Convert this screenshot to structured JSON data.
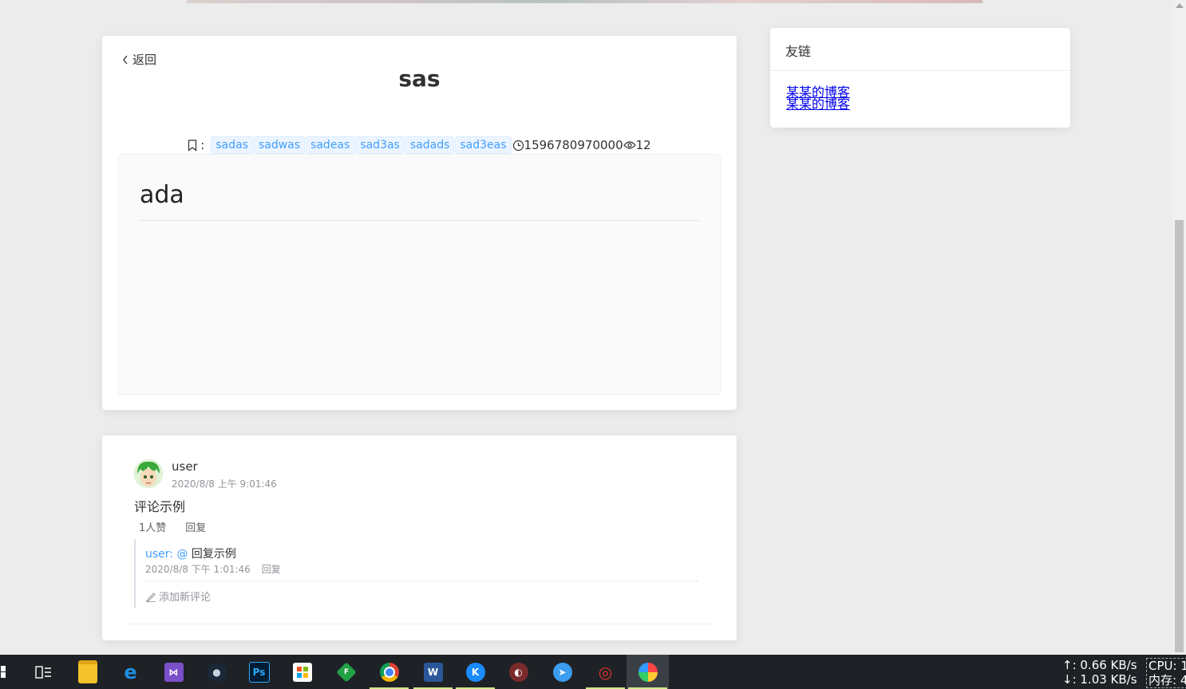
{
  "article": {
    "back_label": "返回",
    "title": "sas",
    "tag_label": ":",
    "tags": [
      "sadas",
      "sadwas",
      "sadeas",
      "sad3as",
      "sadads",
      "sad3eas"
    ],
    "timestamp": "1596780970000",
    "views": "12",
    "content_heading": "ada"
  },
  "friends": {
    "title": "友链",
    "links": [
      "某某的博客",
      "某某的博客"
    ]
  },
  "comment": {
    "user": "user",
    "time": "2020/8/8 上午 9:01:46",
    "text": "评论示例",
    "likes": "1人赞",
    "reply_label": "回复",
    "reply": {
      "user": "user:",
      "at": "@",
      "text": "回复示例",
      "time": "2020/8/8 下午 1:01:46",
      "reply_label": "回复"
    },
    "add_label": "添加新评论"
  },
  "taskbar": {
    "net_up": "↑: 0.66 KB/s",
    "net_down": "↓: 1.03 KB/s",
    "cpu": "CPU: 1",
    "mem": "内存: 4",
    "apps": [
      "start-icon",
      "task-view-icon",
      "file-explorer-icon",
      "edge-icon",
      "visual-studio-icon",
      "steam-icon",
      "photoshop-icon",
      "store-icon",
      "app-f-icon",
      "chrome-icon",
      "word-icon",
      "kugou-icon",
      "game-icon",
      "feishu-icon",
      "weibo-icon",
      "colorful-app-icon"
    ]
  },
  "colors": {
    "accent": "#409eff",
    "background": "#ececec",
    "taskbar": "#1e2226"
  }
}
